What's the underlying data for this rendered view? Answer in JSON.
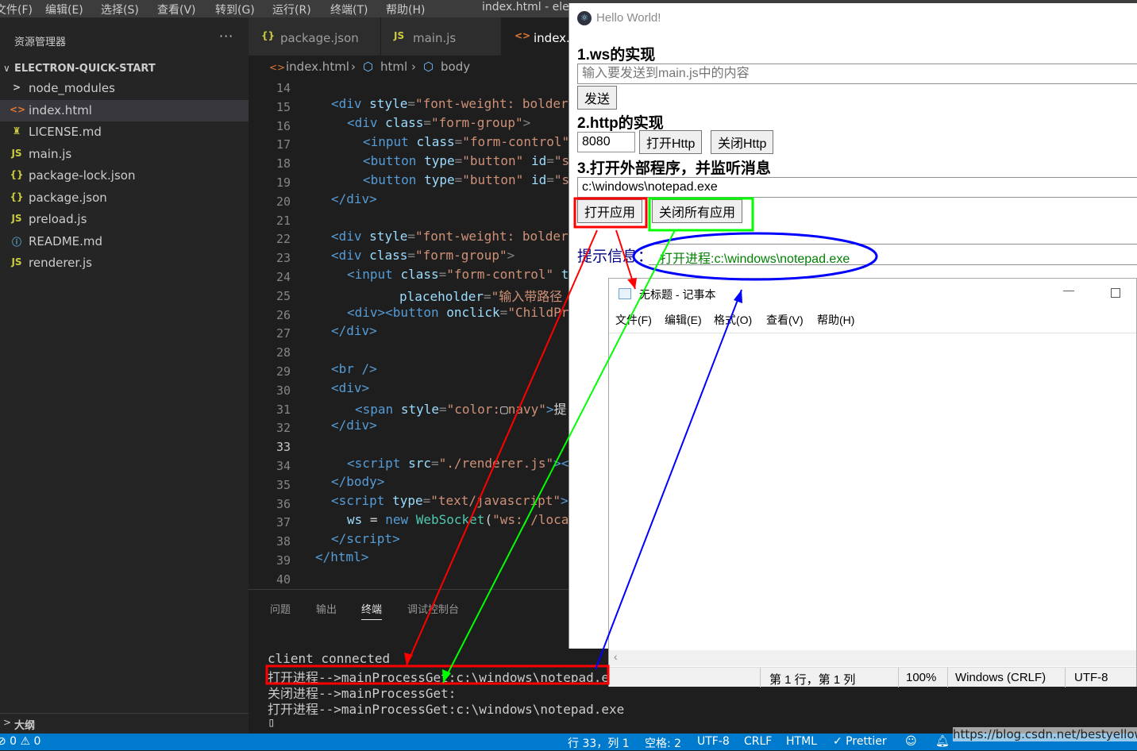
{
  "menu": {
    "items": [
      "文件(F)",
      "编辑(E)",
      "选择(S)",
      "查看(V)",
      "转到(G)",
      "运行(R)",
      "终端(T)",
      "帮助(H)"
    ],
    "window_title": "index.html - elec"
  },
  "sidebar": {
    "title": "资源管理器",
    "more": "···",
    "workspace": "ELECTRON-QUICK-START",
    "items": [
      {
        "name": "node_modules",
        "icon": ">",
        "icon_name": "chevron-right-icon",
        "color": "#cccccc"
      },
      {
        "name": "index.html",
        "icon": "<>",
        "icon_name": "html-file-icon",
        "color": "#e37933",
        "selected": true
      },
      {
        "name": "LICENSE.md",
        "icon": "♜",
        "icon_name": "license-file-icon",
        "color": "#cbcb41"
      },
      {
        "name": "main.js",
        "icon": "JS",
        "icon_name": "js-file-icon",
        "color": "#cbcb41"
      },
      {
        "name": "package-lock.json",
        "icon": "{}",
        "icon_name": "json-file-icon",
        "color": "#cbcb41"
      },
      {
        "name": "package.json",
        "icon": "{}",
        "icon_name": "json-file-icon",
        "color": "#cbcb41"
      },
      {
        "name": "preload.js",
        "icon": "JS",
        "icon_name": "js-file-icon",
        "color": "#cbcb41"
      },
      {
        "name": "README.md",
        "icon": "ⓘ",
        "icon_name": "info-file-icon",
        "color": "#519aba"
      },
      {
        "name": "renderer.js",
        "icon": "JS",
        "icon_name": "js-file-icon",
        "color": "#cbcb41"
      }
    ],
    "outline": "大纲"
  },
  "tabs": [
    {
      "name": "package.json",
      "icon": "{}",
      "color": "#cbcb41"
    },
    {
      "name": "main.js",
      "icon": "JS",
      "color": "#cbcb41"
    },
    {
      "name": "index.",
      "icon": "<>",
      "color": "#e37933",
      "active": true
    }
  ],
  "breadcrumb": [
    "index.html",
    "html",
    "body"
  ],
  "editor": {
    "line_numbers": [
      "14",
      "15",
      "16",
      "17",
      "18",
      "19",
      "20",
      "21",
      "22",
      "23",
      "24",
      "25",
      "26",
      "27",
      "28",
      "29",
      "30",
      "31",
      "32",
      "33",
      "34",
      "35",
      "36",
      "37",
      "38",
      "39",
      "40"
    ],
    "current_line": "33"
  },
  "panel": {
    "tabs": [
      "问题",
      "输出",
      "终端",
      "调试控制台"
    ],
    "active_tab": "终端",
    "terminal_lines": [
      "client connected",
      "打开进程-->mainProcessGet:c:\\windows\\notepad.exe",
      "关闭进程-->mainProcessGet:",
      "打开进程-->mainProcessGet:c:\\windows\\notepad.exe",
      "▯"
    ]
  },
  "statusbar": {
    "left": "⊘ 0 ⚠ 0",
    "items": [
      "行 33，列 1",
      "空格: 2",
      "UTF-8",
      "CRLF",
      "HTML",
      "✓ Prettier"
    ],
    "color": "#007acc"
  },
  "app": {
    "title": "Hello World!",
    "sections": [
      "1.ws的实现",
      "2.http的实现",
      "3.打开外部程序，并监听消息"
    ],
    "ws_input_placeholder": "输入要发送到main.js中的内容",
    "send_button": "发送",
    "port_value": "8080",
    "open_http_button": "打开Http",
    "close_http_button": "关闭Http",
    "path_value": "c:\\windows\\notepad.exe",
    "open_app_button": "打开应用",
    "close_all_button": "关闭所有应用",
    "hint_label": "提示信息：",
    "hint_value": "打开进程:c:\\windows\\notepad.exe"
  },
  "notepad": {
    "title": "无标题 - 记事本",
    "menu": [
      "文件(F)",
      "编辑(E)",
      "格式(O)",
      "查看(V)",
      "帮助(H)"
    ],
    "status": [
      "第 1 行，第 1 列",
      "100%",
      "Windows (CRLF)",
      "UTF-8"
    ]
  },
  "watermark": "https://blog.csdn.net/bestyellow",
  "annotation_colors": {
    "red": "#ff0000",
    "green": "#00ff00",
    "blue": "#0000ff"
  }
}
